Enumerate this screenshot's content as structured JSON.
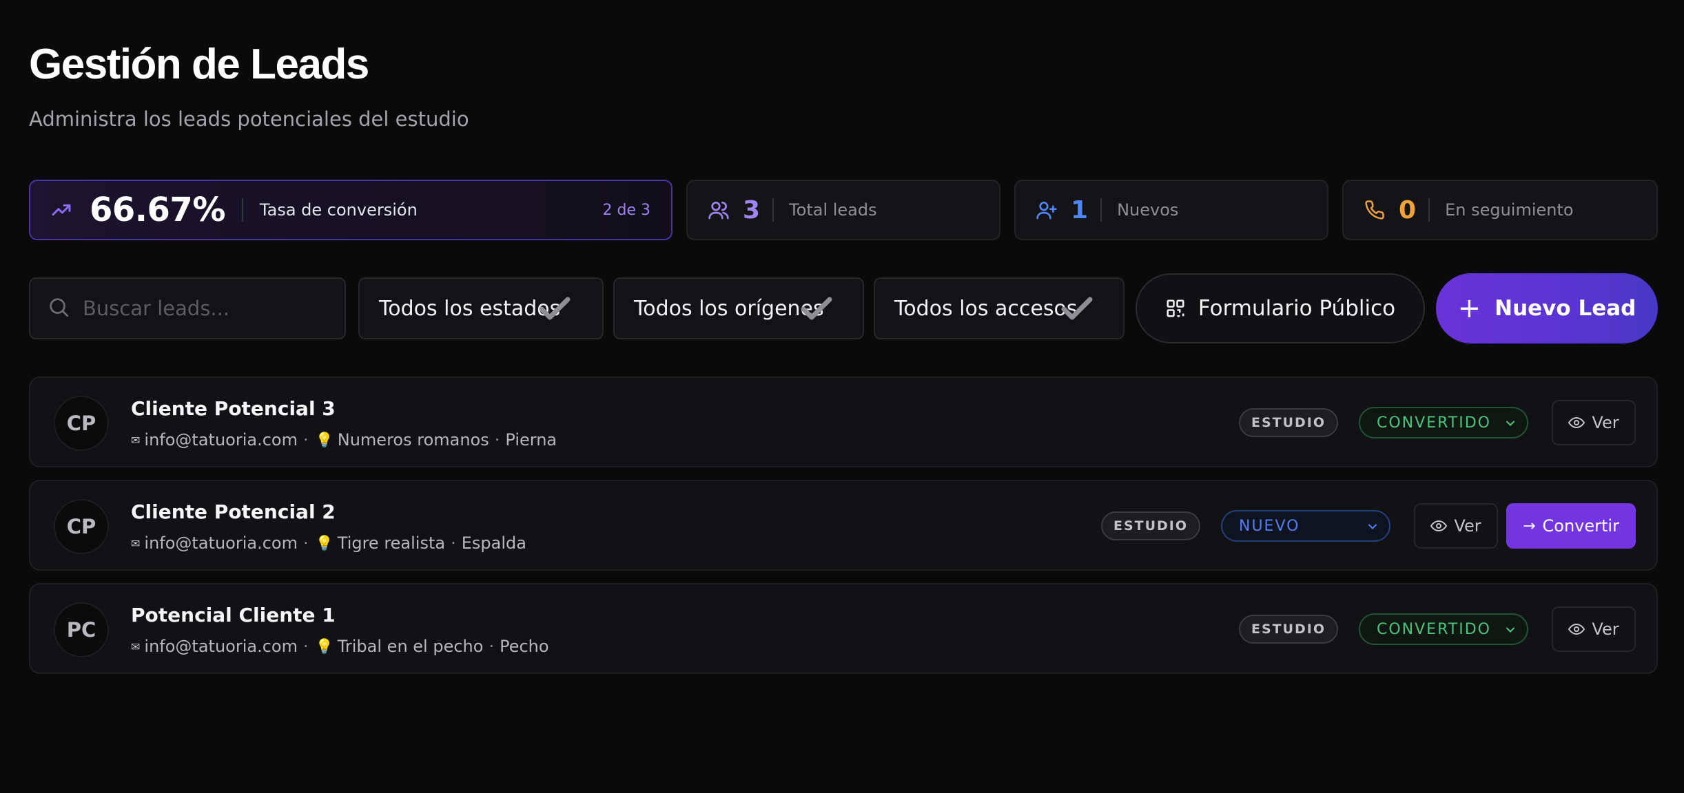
{
  "header": {
    "title": "Gestión de Leads",
    "subtitle": "Administra los leads potenciales del estudio"
  },
  "stats": {
    "conversion": {
      "value": "66.67%",
      "label": "Tasa de conversión",
      "fraction": "2 de 3",
      "icon": "trending-up-icon",
      "color": "#8b6cf0"
    },
    "total": {
      "value": "3",
      "label": "Total leads",
      "icon": "users-icon",
      "color": "#9d86f2"
    },
    "new": {
      "value": "1",
      "label": "Nuevos",
      "icon": "user-plus-icon",
      "color": "#4f86f7"
    },
    "follow": {
      "value": "0",
      "label": "En seguimiento",
      "icon": "phone-icon",
      "color": "#f1a23a"
    }
  },
  "toolbar": {
    "search_placeholder": "Buscar leads...",
    "filter_status": "Todos los estados",
    "filter_origin": "Todos los orígenes",
    "filter_access": "Todos los accesos",
    "public_form": "Formulario Público",
    "new_lead": "Nuevo Lead"
  },
  "leads": [
    {
      "initials": "CP",
      "name": "Cliente Potencial 3",
      "email": "info@tatuoria.com",
      "idea": "Numeros romanos",
      "zone": "Pierna",
      "source": "ESTUDIO",
      "status": "CONVERTIDO",
      "view": "Ver"
    },
    {
      "initials": "CP",
      "name": "Cliente Potencial 2",
      "email": "info@tatuoria.com",
      "idea": "Tigre realista",
      "zone": "Espalda",
      "source": "ESTUDIO",
      "status": "NUEVO",
      "view": "Ver",
      "convert": "Convertir"
    },
    {
      "initials": "PC",
      "name": "Potencial Cliente 1",
      "email": "info@tatuoria.com",
      "idea": "Tribal en el pecho",
      "zone": "Pecho",
      "source": "ESTUDIO",
      "status": "CONVERTIDO",
      "view": "Ver"
    }
  ],
  "colors": {
    "accent": "#6a33da",
    "converted": "#4fc27c",
    "new": "#4f7ff0"
  }
}
